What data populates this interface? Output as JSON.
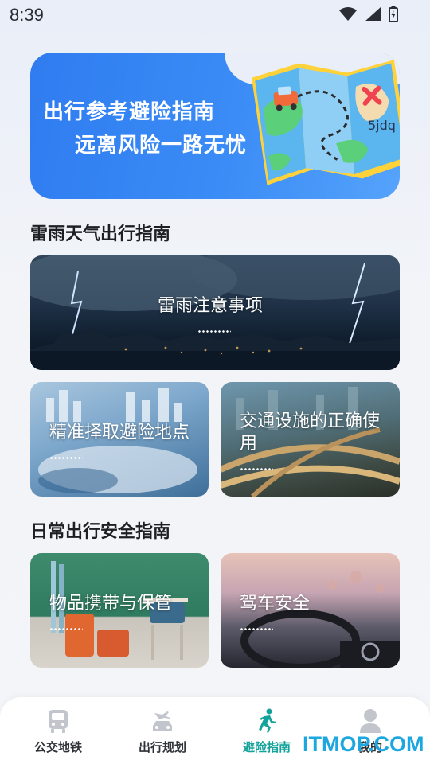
{
  "status_bar": {
    "time": "8:39",
    "icons": [
      "wifi-icon",
      "signal-icon",
      "battery-icon"
    ]
  },
  "banner": {
    "line1": "出行参考避险指南",
    "line2": "远离风险一路无忧",
    "watermark": "5jdq"
  },
  "sections": [
    {
      "title": "雷雨天气出行指南"
    },
    {
      "title": "日常出行安全指南"
    }
  ],
  "cards": {
    "storm": "雷雨注意事项",
    "evac": "精准择取避险地点",
    "traffic": "交通设施的正确使用",
    "items": "物品携带与保管",
    "drive": "驾车安全"
  },
  "nav": {
    "items": [
      {
        "label": "公交地铁",
        "icon": "bus-icon"
      },
      {
        "label": "出行规划",
        "icon": "car-plane-icon"
      },
      {
        "label": "避险指南",
        "icon": "running-person-icon"
      },
      {
        "label": "我的",
        "icon": "person-icon"
      }
    ],
    "active_index": 2,
    "active_color": "#14a39a"
  },
  "overlay_watermark": "ITMOP.COM"
}
